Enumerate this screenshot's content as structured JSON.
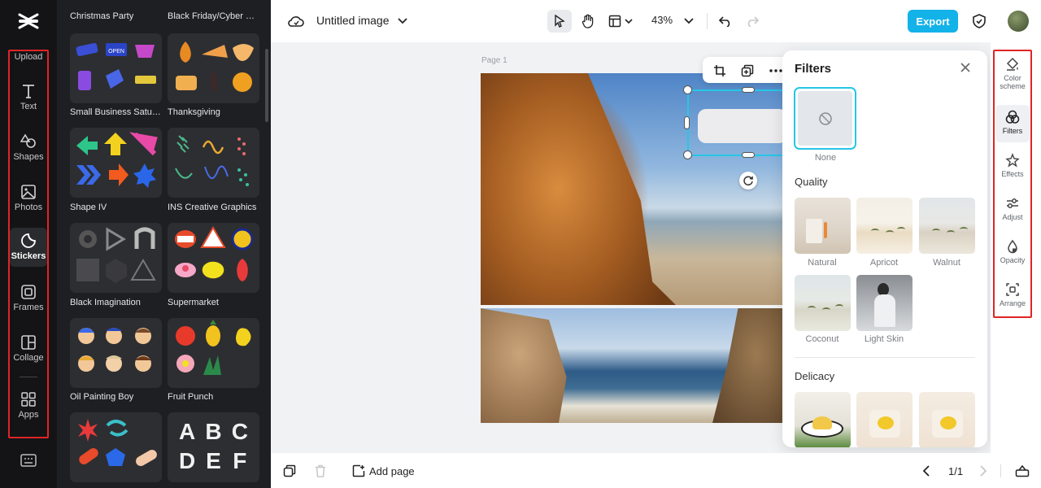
{
  "sidebar": {
    "items": [
      {
        "label": "Upload",
        "icon": "upload-icon"
      },
      {
        "label": "Text",
        "icon": "text-icon"
      },
      {
        "label": "Shapes",
        "icon": "shapes-icon"
      },
      {
        "label": "Photos",
        "icon": "photos-icon"
      },
      {
        "label": "Stickers",
        "icon": "stickers-icon",
        "active": true
      },
      {
        "label": "Frames",
        "icon": "frames-icon"
      },
      {
        "label": "Collage",
        "icon": "collage-icon"
      },
      {
        "label": "Apps",
        "icon": "apps-icon"
      }
    ]
  },
  "stickers": {
    "categories": [
      {
        "label": "Christmas Party"
      },
      {
        "label": "Black Friday/Cyber M..."
      },
      {
        "label": "Small Business Saturd..."
      },
      {
        "label": "Thanksgiving"
      },
      {
        "label": "Shape IV"
      },
      {
        "label": "INS Creative Graphics"
      },
      {
        "label": "Black Imagination"
      },
      {
        "label": "Supermarket"
      },
      {
        "label": "Oil Painting Boy"
      },
      {
        "label": "Fruit Punch"
      }
    ],
    "letters": [
      "A",
      "B",
      "C",
      "D",
      "E",
      "F"
    ],
    "open_label": "OPEN"
  },
  "header": {
    "title": "Untitled image",
    "zoom": "43%",
    "export_label": "Export"
  },
  "canvas": {
    "page_label": "Page 1"
  },
  "filters": {
    "title": "Filters",
    "none_label": "None",
    "sections": [
      {
        "title": "Quality",
        "items": [
          "Natural",
          "Apricot",
          "Walnut",
          "Coconut",
          "Light Skin"
        ]
      },
      {
        "title": "Delicacy",
        "items": []
      }
    ]
  },
  "right_rail": {
    "items": [
      {
        "label": "Color scheme",
        "icon": "color-scheme-icon"
      },
      {
        "label": "Filters",
        "icon": "filters-icon",
        "active": true
      },
      {
        "label": "Effects",
        "icon": "effects-icon"
      },
      {
        "label": "Adjust",
        "icon": "adjust-icon"
      },
      {
        "label": "Opacity",
        "icon": "opacity-icon"
      },
      {
        "label": "Arrange",
        "icon": "arrange-icon"
      }
    ]
  },
  "footer": {
    "add_page_label": "Add page",
    "page_count": "1/1"
  },
  "colors": {
    "accent": "#13b2e8",
    "selection": "#26c6e6",
    "highlight_red": "#e02424"
  }
}
